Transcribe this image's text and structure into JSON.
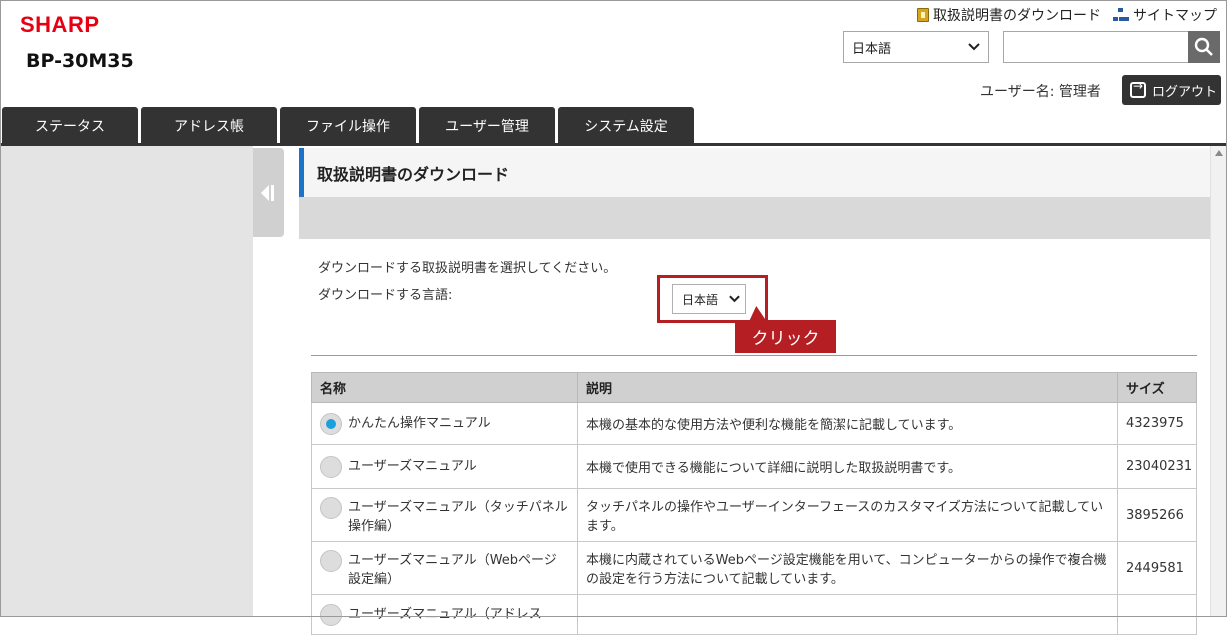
{
  "header": {
    "logo": "SHARP",
    "model": "BP-30M35",
    "links": {
      "manual_download": "取扱説明書のダウンロード",
      "sitemap": "サイトマップ"
    },
    "language_select": {
      "value": "日本語"
    },
    "search": {
      "placeholder": ""
    },
    "user_label": "ユーザー名: 管理者",
    "logout_label": "ログアウト"
  },
  "tabs": [
    "ステータス",
    "アドレス帳",
    "ファイル操作",
    "ユーザー管理",
    "システム設定"
  ],
  "content": {
    "title": "取扱説明書のダウンロード",
    "instruction": "ダウンロードする取扱説明書を選択してください。",
    "language_label": "ダウンロードする言語:",
    "language_value": "日本語",
    "callout": "クリック"
  },
  "table": {
    "headers": [
      "名称",
      "説明",
      "サイズ"
    ],
    "rows": [
      {
        "name": "かんたん操作マニュアル",
        "desc": "本機の基本的な使用方法や便利な機能を簡潔に記載しています。",
        "size": "4323975",
        "selected": true
      },
      {
        "name": "ユーザーズマニュアル",
        "desc": "本機で使用できる機能について詳細に説明した取扱説明書です。",
        "size": "23040231",
        "selected": false
      },
      {
        "name": "ユーザーズマニュアル（タッチパネル操作編）",
        "desc": "タッチパネルの操作やユーザーインターフェースのカスタマイズ方法について記載しています。",
        "size": "3895266",
        "selected": false
      },
      {
        "name": "ユーザーズマニュアル（Webページ設定編）",
        "desc": "本機に内蔵されているWebページ設定機能を用いて、コンピューターからの操作で複合機の設定を行う方法について記載しています。",
        "size": "2449581",
        "selected": false
      },
      {
        "name": "ユーザーズマニュアル（アドレス",
        "desc": "",
        "size": "",
        "selected": false
      }
    ]
  },
  "colors": {
    "brand": "#e60012",
    "accent": "#1a73c8",
    "highlight": "#b51e23",
    "radio_on": "#1aa0dc"
  }
}
